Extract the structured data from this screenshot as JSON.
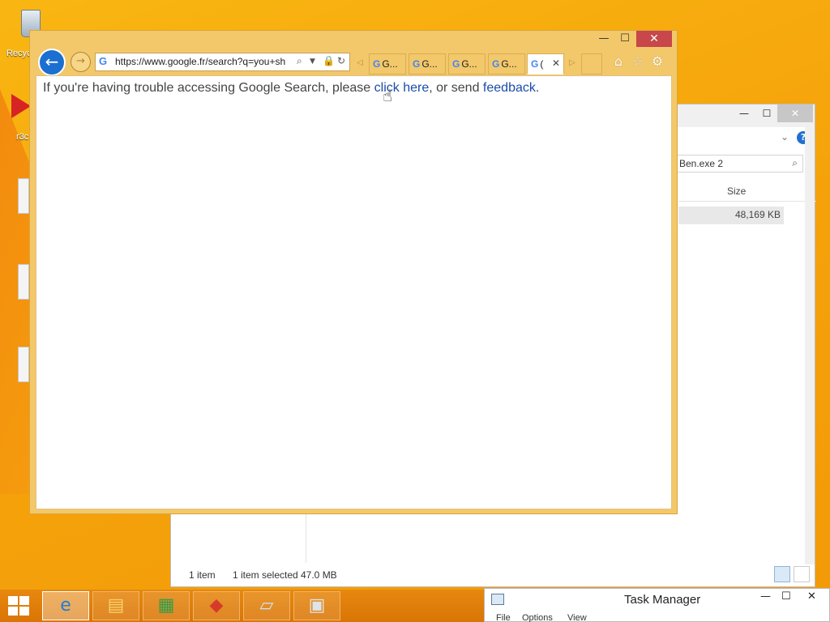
{
  "desktop": {
    "recycle_label": "Recyc",
    "red_icon_label": "r3c"
  },
  "explorer": {
    "search_value": "Ben.exe 2",
    "col_size": "Size",
    "row_size": "48,169 KB",
    "status_items": "1 item",
    "status_selected": "1 item selected",
    "status_size": "47.0 MB"
  },
  "ie": {
    "url": "https://www.google.fr/search?q=you+sh",
    "tabs": [
      {
        "label": "G..."
      },
      {
        "label": "G..."
      },
      {
        "label": "G..."
      },
      {
        "label": "G..."
      },
      {
        "label": "("
      }
    ],
    "message_prefix": "If you're having trouble accessing Google Search, please ",
    "link_click_here": "click here",
    "message_middle": ", or send ",
    "link_feedback": "feedback",
    "message_suffix": "."
  },
  "taskmanager": {
    "title": "Task Manager",
    "menu": [
      "File",
      "Options",
      "View"
    ]
  },
  "colors": {
    "desktop": "#f6a30c",
    "ie_frame": "#f3c86a",
    "close_red": "#c7474a",
    "link": "#1a4ca8"
  }
}
